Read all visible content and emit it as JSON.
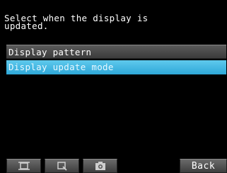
{
  "prompt": {
    "line1": "Select when the display is",
    "line2": "updated."
  },
  "menu": {
    "items": [
      {
        "label": "Display pattern",
        "selected": false
      },
      {
        "label": "Display update mode",
        "selected": true
      }
    ]
  },
  "toolbar": {
    "buttons": [
      {
        "icon": "fit-screen-icon"
      },
      {
        "icon": "zoom-icon"
      },
      {
        "icon": "camera-icon"
      }
    ],
    "back_label": "Back"
  },
  "colors": {
    "background": "#000000",
    "menu_item": "#4a4a4a",
    "menu_selected": "#3ab7e3",
    "button": "#555555"
  }
}
